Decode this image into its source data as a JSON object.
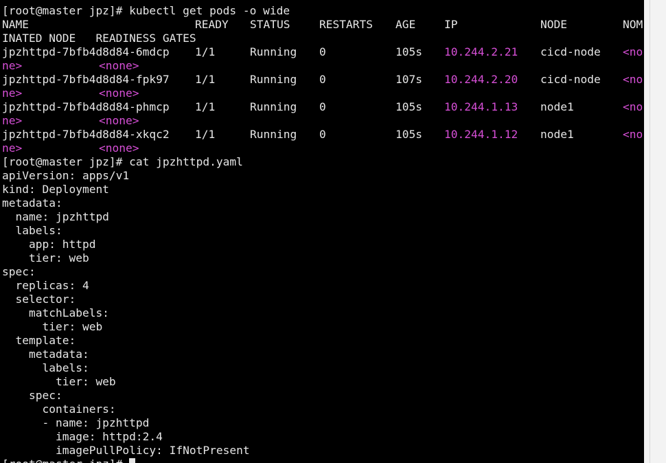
{
  "terminal": {
    "cmd1": "[root@master jpz]# kubectl get pods -o wide",
    "header": {
      "cols": [
        "NAME",
        "READY",
        "STATUS",
        "RESTARTS",
        "AGE",
        "IP",
        "NODE",
        "NOM"
      ],
      "wrap": "INATED NODE   READINESS GATES"
    },
    "pods": [
      {
        "name": "jpzhttpd-7bfb4d8d84-6mdcp",
        "ready": "1/1",
        "status": "Running",
        "restarts": "0",
        "age": "105s",
        "ip": "10.244.2.21",
        "node": "cicd-node",
        "nom": "<no",
        "wrap_a": "ne>",
        "wrap_b": "<none>"
      },
      {
        "name": "jpzhttpd-7bfb4d8d84-fpk97",
        "ready": "1/1",
        "status": "Running",
        "restarts": "0",
        "age": "107s",
        "ip": "10.244.2.20",
        "node": "cicd-node",
        "nom": "<no",
        "wrap_a": "ne>",
        "wrap_b": "<none>"
      },
      {
        "name": "jpzhttpd-7bfb4d8d84-phmcp",
        "ready": "1/1",
        "status": "Running",
        "restarts": "0",
        "age": "105s",
        "ip": "10.244.1.13",
        "node": "node1",
        "nom": "<no",
        "wrap_a": "ne>",
        "wrap_b": "<none>"
      },
      {
        "name": "jpzhttpd-7bfb4d8d84-xkqc2",
        "ready": "1/1",
        "status": "Running",
        "restarts": "0",
        "age": "105s",
        "ip": "10.244.1.12",
        "node": "node1",
        "nom": "<no",
        "wrap_a": "ne>",
        "wrap_b": "<none>"
      }
    ],
    "cmd2": "[root@master jpz]# cat jpzhttpd.yaml",
    "yaml": [
      "apiVersion: apps/v1",
      "kind: Deployment",
      "metadata:",
      "  name: jpzhttpd",
      "  labels:",
      "    app: httpd",
      "    tier: web",
      "spec:",
      "  replicas: 4",
      "  selector:",
      "    matchLabels:",
      "      tier: web",
      "  template:",
      "    metadata:",
      "      labels:",
      "        tier: web",
      "    spec:",
      "      containers:",
      "      - name: jpzhttpd",
      "        image: httpd:2.4",
      "        imagePullPolicy: IfNotPresent"
    ],
    "prompt_end": "[root@master jpz]# ",
    "colors": {
      "bg": "#000000",
      "fg": "#e6e6e6",
      "highlight": "#d64fd6"
    }
  }
}
